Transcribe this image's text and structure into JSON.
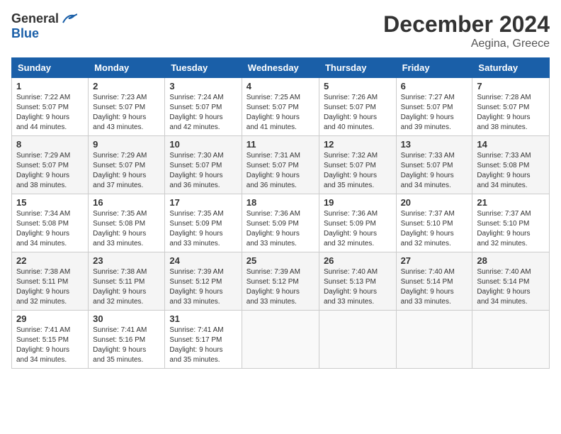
{
  "header": {
    "logo_general": "General",
    "logo_blue": "Blue",
    "month_year": "December 2024",
    "location": "Aegina, Greece"
  },
  "weekdays": [
    "Sunday",
    "Monday",
    "Tuesday",
    "Wednesday",
    "Thursday",
    "Friday",
    "Saturday"
  ],
  "weeks": [
    [
      {
        "day": "1",
        "info": "Sunrise: 7:22 AM\nSunset: 5:07 PM\nDaylight: 9 hours\nand 44 minutes."
      },
      {
        "day": "2",
        "info": "Sunrise: 7:23 AM\nSunset: 5:07 PM\nDaylight: 9 hours\nand 43 minutes."
      },
      {
        "day": "3",
        "info": "Sunrise: 7:24 AM\nSunset: 5:07 PM\nDaylight: 9 hours\nand 42 minutes."
      },
      {
        "day": "4",
        "info": "Sunrise: 7:25 AM\nSunset: 5:07 PM\nDaylight: 9 hours\nand 41 minutes."
      },
      {
        "day": "5",
        "info": "Sunrise: 7:26 AM\nSunset: 5:07 PM\nDaylight: 9 hours\nand 40 minutes."
      },
      {
        "day": "6",
        "info": "Sunrise: 7:27 AM\nSunset: 5:07 PM\nDaylight: 9 hours\nand 39 minutes."
      },
      {
        "day": "7",
        "info": "Sunrise: 7:28 AM\nSunset: 5:07 PM\nDaylight: 9 hours\nand 38 minutes."
      }
    ],
    [
      {
        "day": "8",
        "info": "Sunrise: 7:29 AM\nSunset: 5:07 PM\nDaylight: 9 hours\nand 38 minutes."
      },
      {
        "day": "9",
        "info": "Sunrise: 7:29 AM\nSunset: 5:07 PM\nDaylight: 9 hours\nand 37 minutes."
      },
      {
        "day": "10",
        "info": "Sunrise: 7:30 AM\nSunset: 5:07 PM\nDaylight: 9 hours\nand 36 minutes."
      },
      {
        "day": "11",
        "info": "Sunrise: 7:31 AM\nSunset: 5:07 PM\nDaylight: 9 hours\nand 36 minutes."
      },
      {
        "day": "12",
        "info": "Sunrise: 7:32 AM\nSunset: 5:07 PM\nDaylight: 9 hours\nand 35 minutes."
      },
      {
        "day": "13",
        "info": "Sunrise: 7:33 AM\nSunset: 5:07 PM\nDaylight: 9 hours\nand 34 minutes."
      },
      {
        "day": "14",
        "info": "Sunrise: 7:33 AM\nSunset: 5:08 PM\nDaylight: 9 hours\nand 34 minutes."
      }
    ],
    [
      {
        "day": "15",
        "info": "Sunrise: 7:34 AM\nSunset: 5:08 PM\nDaylight: 9 hours\nand 34 minutes."
      },
      {
        "day": "16",
        "info": "Sunrise: 7:35 AM\nSunset: 5:08 PM\nDaylight: 9 hours\nand 33 minutes."
      },
      {
        "day": "17",
        "info": "Sunrise: 7:35 AM\nSunset: 5:09 PM\nDaylight: 9 hours\nand 33 minutes."
      },
      {
        "day": "18",
        "info": "Sunrise: 7:36 AM\nSunset: 5:09 PM\nDaylight: 9 hours\nand 33 minutes."
      },
      {
        "day": "19",
        "info": "Sunrise: 7:36 AM\nSunset: 5:09 PM\nDaylight: 9 hours\nand 32 minutes."
      },
      {
        "day": "20",
        "info": "Sunrise: 7:37 AM\nSunset: 5:10 PM\nDaylight: 9 hours\nand 32 minutes."
      },
      {
        "day": "21",
        "info": "Sunrise: 7:37 AM\nSunset: 5:10 PM\nDaylight: 9 hours\nand 32 minutes."
      }
    ],
    [
      {
        "day": "22",
        "info": "Sunrise: 7:38 AM\nSunset: 5:11 PM\nDaylight: 9 hours\nand 32 minutes."
      },
      {
        "day": "23",
        "info": "Sunrise: 7:38 AM\nSunset: 5:11 PM\nDaylight: 9 hours\nand 32 minutes."
      },
      {
        "day": "24",
        "info": "Sunrise: 7:39 AM\nSunset: 5:12 PM\nDaylight: 9 hours\nand 33 minutes."
      },
      {
        "day": "25",
        "info": "Sunrise: 7:39 AM\nSunset: 5:12 PM\nDaylight: 9 hours\nand 33 minutes."
      },
      {
        "day": "26",
        "info": "Sunrise: 7:40 AM\nSunset: 5:13 PM\nDaylight: 9 hours\nand 33 minutes."
      },
      {
        "day": "27",
        "info": "Sunrise: 7:40 AM\nSunset: 5:14 PM\nDaylight: 9 hours\nand 33 minutes."
      },
      {
        "day": "28",
        "info": "Sunrise: 7:40 AM\nSunset: 5:14 PM\nDaylight: 9 hours\nand 34 minutes."
      }
    ],
    [
      {
        "day": "29",
        "info": "Sunrise: 7:41 AM\nSunset: 5:15 PM\nDaylight: 9 hours\nand 34 minutes."
      },
      {
        "day": "30",
        "info": "Sunrise: 7:41 AM\nSunset: 5:16 PM\nDaylight: 9 hours\nand 35 minutes."
      },
      {
        "day": "31",
        "info": "Sunrise: 7:41 AM\nSunset: 5:17 PM\nDaylight: 9 hours\nand 35 minutes."
      },
      {
        "day": "",
        "info": ""
      },
      {
        "day": "",
        "info": ""
      },
      {
        "day": "",
        "info": ""
      },
      {
        "day": "",
        "info": ""
      }
    ]
  ]
}
